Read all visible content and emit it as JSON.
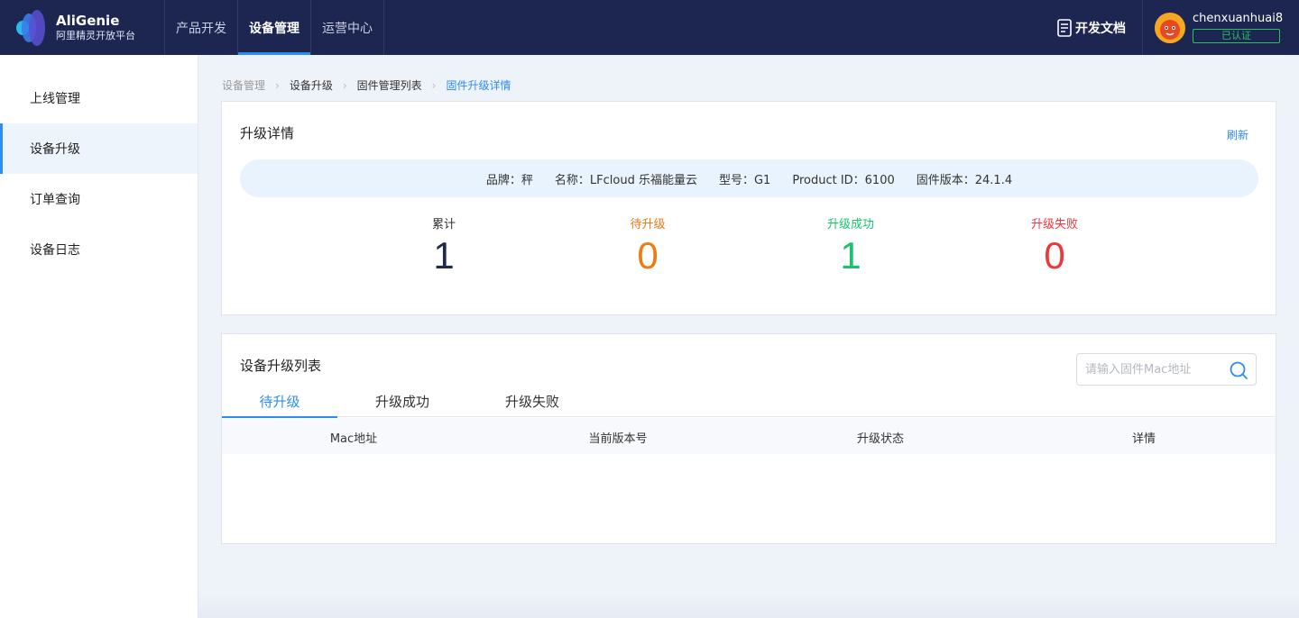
{
  "brand": {
    "name": "AliGenie",
    "subtitle": "阿里精灵开放平台"
  },
  "topnav": {
    "items": [
      {
        "label": "产品开发",
        "active": false
      },
      {
        "label": "设备管理",
        "active": true
      },
      {
        "label": "运营中心",
        "active": false
      }
    ],
    "docs_label": "开发文档",
    "user": {
      "name": "chenxuanhuai8",
      "badge": "已认证"
    }
  },
  "sidebar": {
    "items": [
      {
        "label": "上线管理",
        "active": false
      },
      {
        "label": "设备升级",
        "active": true
      },
      {
        "label": "订单查询",
        "active": false
      },
      {
        "label": "设备日志",
        "active": false
      }
    ]
  },
  "breadcrumb": [
    "设备管理",
    "设备升级",
    "固件管理列表",
    "固件升级详情"
  ],
  "detail": {
    "title": "升级详情",
    "refresh_label": "刷新",
    "info": {
      "brand": "品牌：秤",
      "name": "名称：LFcloud 乐福能量云",
      "model": "型号：G1",
      "product_id": "Product ID：6100",
      "firmware": "固件版本：24.1.4"
    },
    "stats": [
      {
        "label": "累计",
        "value": "1",
        "color": "#1f2a4d"
      },
      {
        "label": "待升级",
        "value": "0",
        "color": "#f07a16"
      },
      {
        "label": "升级成功",
        "value": "1",
        "color": "#19c26b"
      },
      {
        "label": "升级失败",
        "value": "0",
        "color": "#f0363b"
      }
    ]
  },
  "list": {
    "title": "设备升级列表",
    "search_placeholder": "请输入固件Mac地址",
    "tabs": [
      {
        "label": "待升级",
        "active": true
      },
      {
        "label": "升级成功",
        "active": false
      },
      {
        "label": "升级失败",
        "active": false
      }
    ],
    "columns": [
      "Mac地址",
      "当前版本号",
      "升级状态",
      "详情"
    ],
    "rows": []
  },
  "colors": {
    "nav_bg": "#1d2650",
    "accent": "#2d8cf0",
    "verified": "#2cbf63"
  }
}
